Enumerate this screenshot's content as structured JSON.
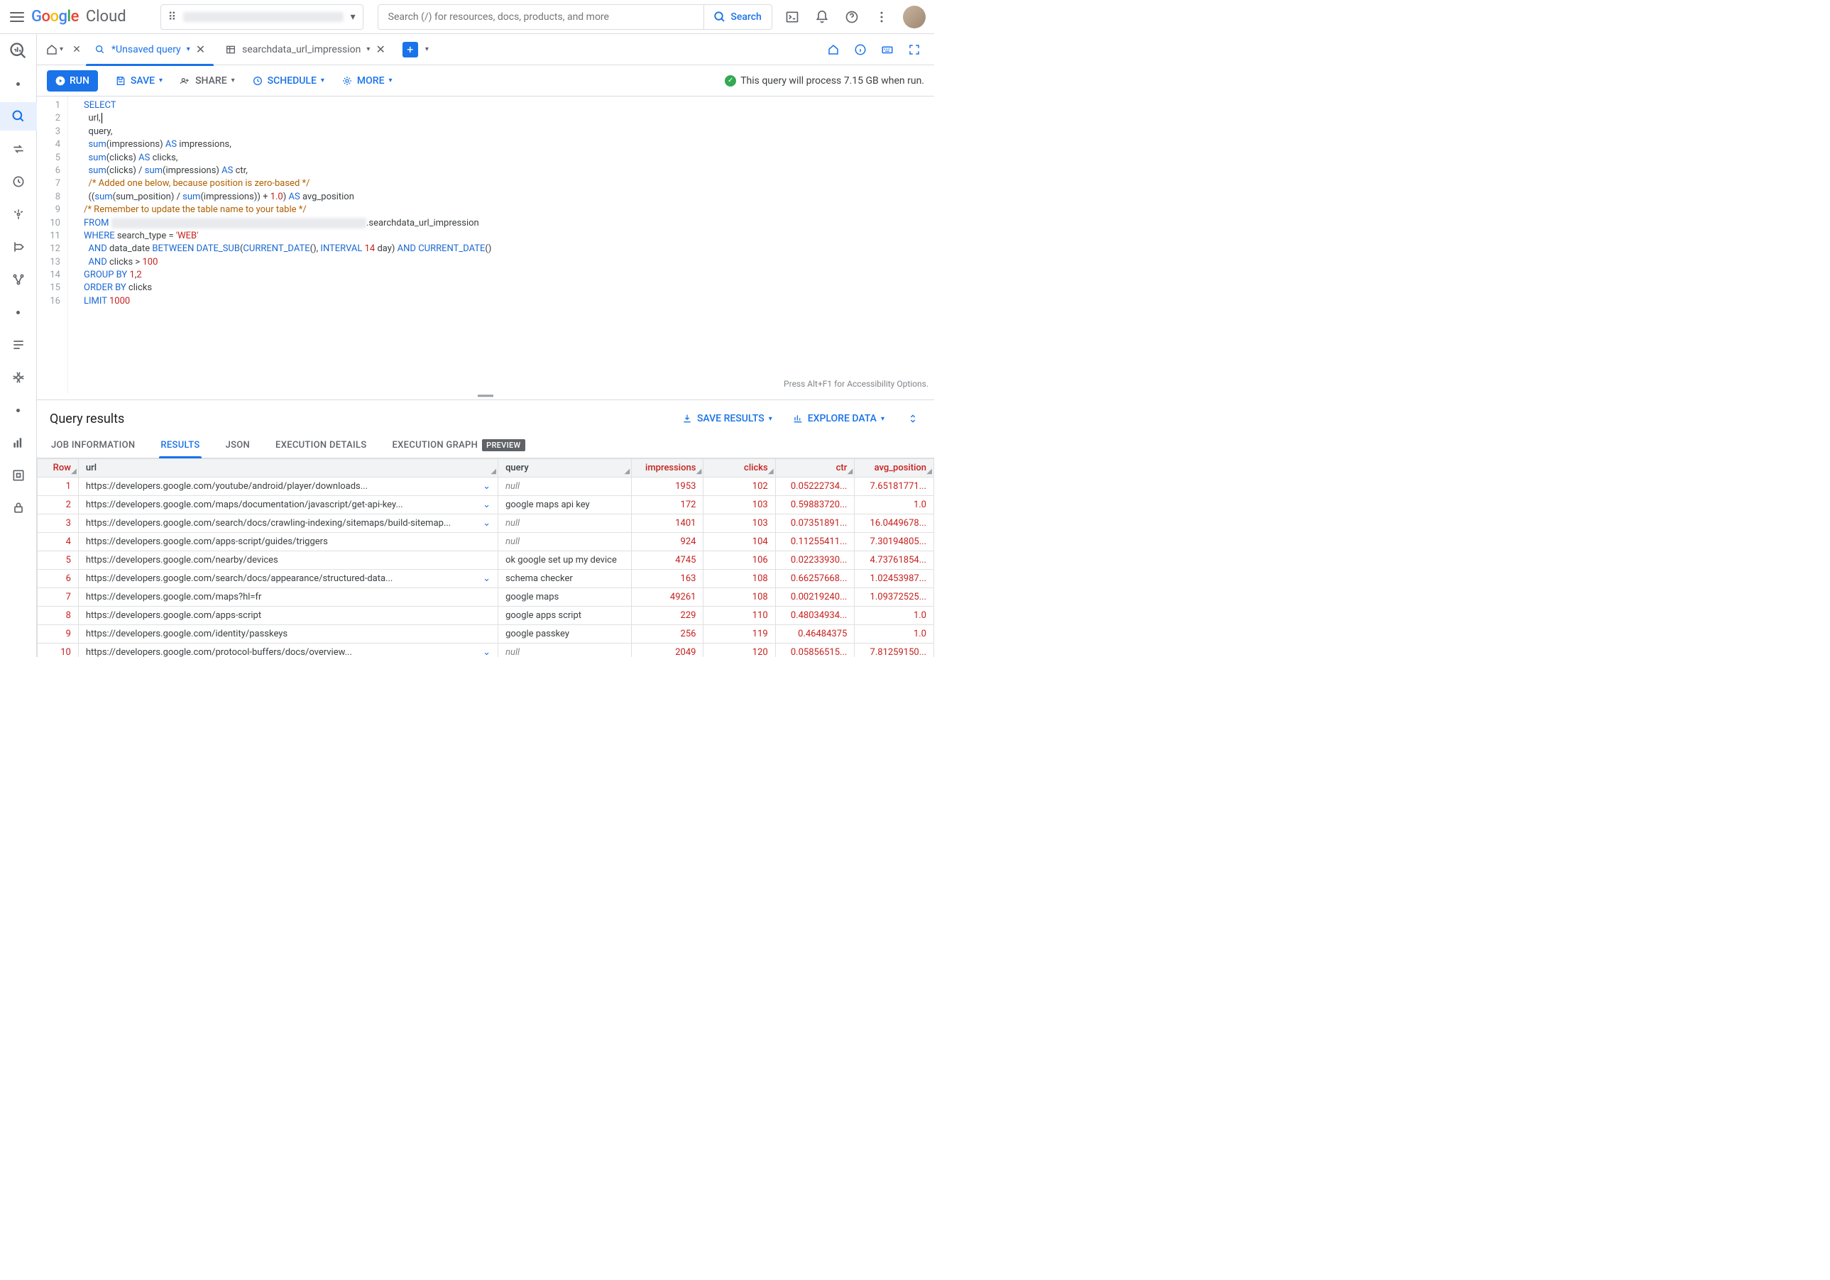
{
  "header": {
    "logo_prefix": "Google",
    "logo_suffix": "Cloud",
    "search_placeholder": "Search (/) for resources, docs, products, and more",
    "search_button": "Search"
  },
  "tabs": {
    "unsaved": "*Unsaved query",
    "table_tab": "searchdata_url_impression"
  },
  "actions": {
    "run": "RUN",
    "save": "SAVE",
    "share": "SHARE",
    "schedule": "SCHEDULE",
    "more": "MORE",
    "process_msg": "This query will process 7.15 GB when run."
  },
  "sql": {
    "lines": [
      "SELECT",
      "  url,",
      "  query,",
      "  sum(impressions) AS impressions,",
      "  sum(clicks) AS clicks,",
      "  sum(clicks) / sum(impressions) AS ctr,",
      "  /* Added one below, because position is zero-based */",
      "  ((sum(sum_position) / sum(impressions)) + 1.0) AS avg_position",
      "/* Remember to update the table name to your table */",
      "FROM ███████████████████████████████████████.searchdata_url_impression",
      "WHERE search_type = 'WEB'",
      "  AND data_date BETWEEN DATE_SUB(CURRENT_DATE(), INTERVAL 14 day) AND CURRENT_DATE()",
      "  AND clicks > 100",
      "GROUP BY 1,2",
      "ORDER BY clicks",
      "LIMIT 1000"
    ]
  },
  "editor_hint": "Press Alt+F1 for Accessibility Options.",
  "results": {
    "title": "Query results",
    "save_results": "SAVE RESULTS",
    "explore_data": "EXPLORE DATA",
    "tabs": {
      "job": "JOB INFORMATION",
      "results": "RESULTS",
      "json": "JSON",
      "exec": "EXECUTION DETAILS",
      "graph": "EXECUTION GRAPH",
      "preview_badge": "PREVIEW"
    },
    "columns": [
      "Row",
      "url",
      "query",
      "impressions",
      "clicks",
      "ctr",
      "avg_position"
    ],
    "rows": [
      {
        "n": 1,
        "url": "https://developers.google.com/youtube/android/player/downloads...",
        "chev": true,
        "query": null,
        "impressions": 1953,
        "clicks": 102,
        "ctr": "0.05222734...",
        "avg": "7.65181771..."
      },
      {
        "n": 2,
        "url": "https://developers.google.com/maps/documentation/javascript/get-api-key...",
        "chev": true,
        "query": "google maps api key",
        "impressions": 172,
        "clicks": 103,
        "ctr": "0.59883720...",
        "avg": "1.0"
      },
      {
        "n": 3,
        "url": "https://developers.google.com/search/docs/crawling-indexing/sitemaps/build-sitemap...",
        "chev": true,
        "query": null,
        "impressions": 1401,
        "clicks": 103,
        "ctr": "0.07351891...",
        "avg": "16.0449678..."
      },
      {
        "n": 4,
        "url": "https://developers.google.com/apps-script/guides/triggers",
        "chev": false,
        "query": null,
        "impressions": 924,
        "clicks": 104,
        "ctr": "0.11255411...",
        "avg": "7.30194805..."
      },
      {
        "n": 5,
        "url": "https://developers.google.com/nearby/devices",
        "chev": false,
        "query": "ok google set up my device",
        "impressions": 4745,
        "clicks": 106,
        "ctr": "0.02233930...",
        "avg": "4.73761854..."
      },
      {
        "n": 6,
        "url": "https://developers.google.com/search/docs/appearance/structured-data...",
        "chev": true,
        "query": "schema checker",
        "impressions": 163,
        "clicks": 108,
        "ctr": "0.66257668...",
        "avg": "1.02453987..."
      },
      {
        "n": 7,
        "url": "https://developers.google.com/maps?hl=fr",
        "chev": false,
        "query": "google maps",
        "impressions": 49261,
        "clicks": 108,
        "ctr": "0.00219240...",
        "avg": "1.09372525..."
      },
      {
        "n": 8,
        "url": "https://developers.google.com/apps-script",
        "chev": false,
        "query": "google apps script",
        "impressions": 229,
        "clicks": 110,
        "ctr": "0.48034934...",
        "avg": "1.0"
      },
      {
        "n": 9,
        "url": "https://developers.google.com/identity/passkeys",
        "chev": false,
        "query": "google passkey",
        "impressions": 256,
        "clicks": 119,
        "ctr": "0.46484375",
        "avg": "1.0"
      },
      {
        "n": 10,
        "url": "https://developers.google.com/protocol-buffers/docs/overview...",
        "chev": true,
        "query": null,
        "impressions": 2049,
        "clicks": 120,
        "ctr": "0.05856515...",
        "avg": "7.81259150..."
      }
    ]
  }
}
